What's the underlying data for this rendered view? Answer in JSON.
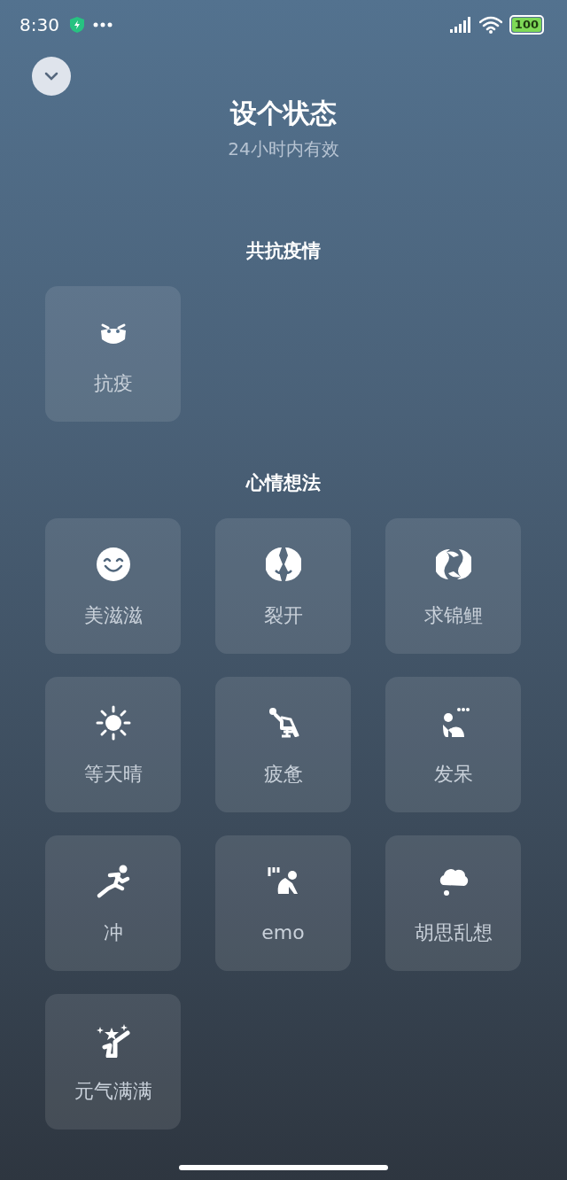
{
  "status_bar": {
    "time": "8:30",
    "battery": "100"
  },
  "header": {
    "title": "设个状态",
    "subtitle": "24小时内有效"
  },
  "sections": [
    {
      "title": "共抗疫情",
      "items": [
        {
          "label": "抗疫",
          "kind": "mask"
        }
      ]
    },
    {
      "title": "心情想法",
      "items": [
        {
          "label": "美滋滋",
          "kind": "smile"
        },
        {
          "label": "裂开",
          "kind": "cracked"
        },
        {
          "label": "求锦鲤",
          "kind": "koi"
        },
        {
          "label": "等天晴",
          "kind": "sun"
        },
        {
          "label": "疲惫",
          "kind": "reclining"
        },
        {
          "label": "发呆",
          "kind": "sitting"
        },
        {
          "label": "冲",
          "kind": "runner"
        },
        {
          "label": "emo",
          "kind": "crouching"
        },
        {
          "label": "胡思乱想",
          "kind": "cloud"
        },
        {
          "label": "元气满满",
          "kind": "star"
        }
      ]
    }
  ]
}
